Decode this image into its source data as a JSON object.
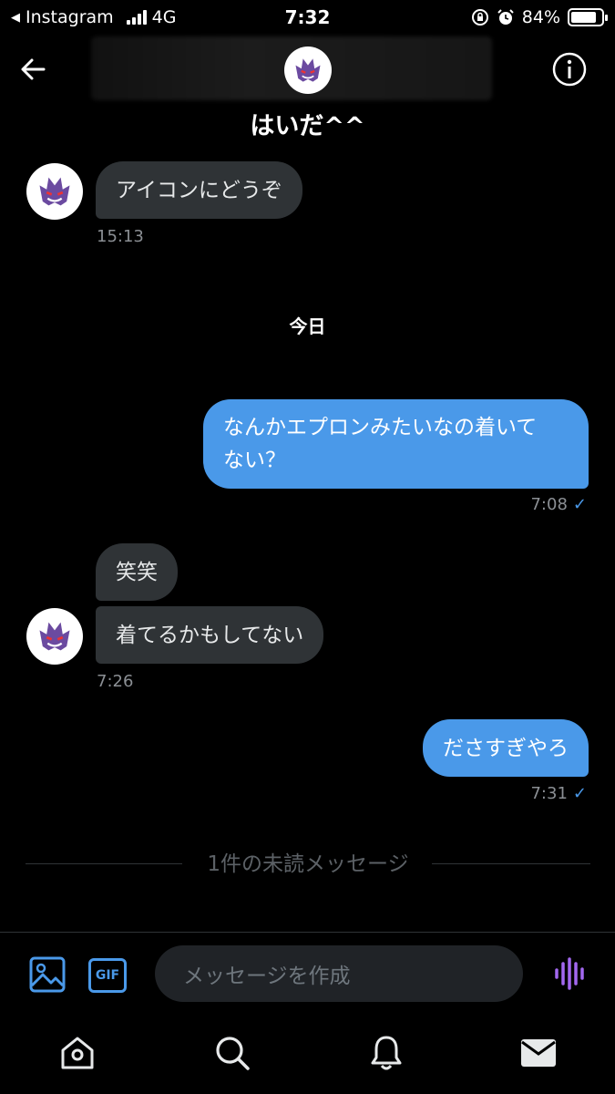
{
  "status": {
    "back_app": "Instagram",
    "network": "4G",
    "time": "7:32",
    "battery": "84%",
    "battery_level": 0.84
  },
  "header": {
    "title": "はいだ^^"
  },
  "messages": {
    "m1": {
      "text": "アイコンにどうぞ",
      "time": "15:13"
    },
    "day": "今日",
    "m2": {
      "line1": "なんかエプロンみたいなの着いて",
      "line2": "ない？",
      "time": "7:08",
      "check": "✓"
    },
    "m3": {
      "text": "笑笑"
    },
    "m4": {
      "text": "着てるかもしてない",
      "time": "7:26"
    },
    "m5": {
      "text": "ださすぎやろ",
      "time": "7:31",
      "check": "✓"
    },
    "unread": "1件の未読メッセージ"
  },
  "composer": {
    "gif_label": "GIF",
    "placeholder": "メッセージを作成"
  },
  "colors": {
    "accent": "#4a99e9",
    "voice": "#a368f0",
    "incoming_bubble": "#2f3336"
  }
}
